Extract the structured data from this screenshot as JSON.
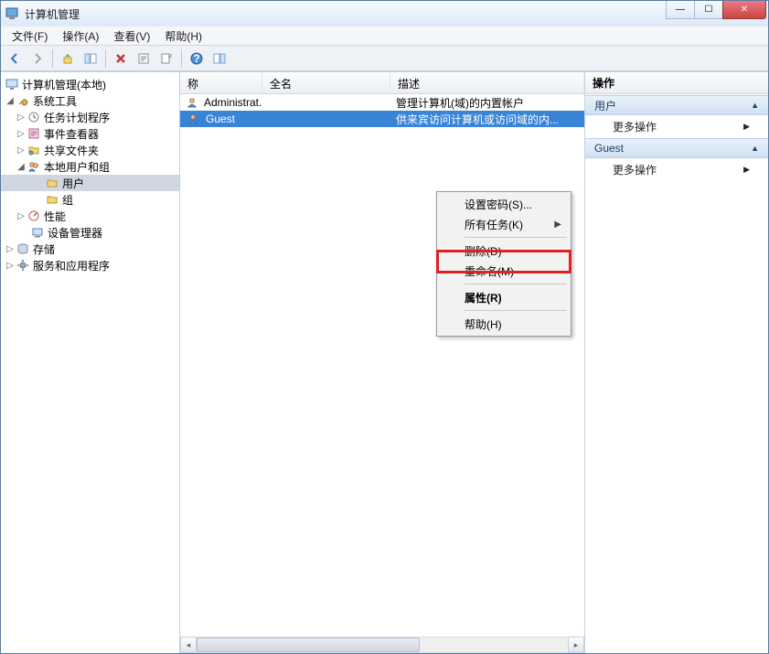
{
  "window": {
    "title": "计算机管理"
  },
  "menubar": {
    "file": "文件(F)",
    "action": "操作(A)",
    "view": "查看(V)",
    "help": "帮助(H)"
  },
  "tree": {
    "root": "计算机管理(本地)",
    "system_tools": "系统工具",
    "task_scheduler": "任务计划程序",
    "event_viewer": "事件查看器",
    "shared_folders": "共享文件夹",
    "local_users_groups": "本地用户和组",
    "users": "用户",
    "groups": "组",
    "performance": "性能",
    "device_manager": "设备管理器",
    "storage": "存储",
    "services_apps": "服务和应用程序"
  },
  "columns": {
    "name": "称",
    "fullname": "全名",
    "desc": "描述"
  },
  "rows": [
    {
      "name": "Administrat...",
      "fullname": "",
      "desc": "管理计算机(域)的内置帐户",
      "selected": false
    },
    {
      "name": "Guest",
      "fullname": "",
      "desc": "供来宾访问计算机或访问域的内...",
      "selected": true
    }
  ],
  "context": {
    "set_password": "设置密码(S)...",
    "all_tasks": "所有任务(K)",
    "delete": "删除(D)",
    "rename": "重命名(M)",
    "properties": "属性(R)",
    "help": "帮助(H)"
  },
  "actions": {
    "header": "操作",
    "group_users": "用户",
    "more_actions": "更多操作",
    "group_guest": "Guest"
  }
}
